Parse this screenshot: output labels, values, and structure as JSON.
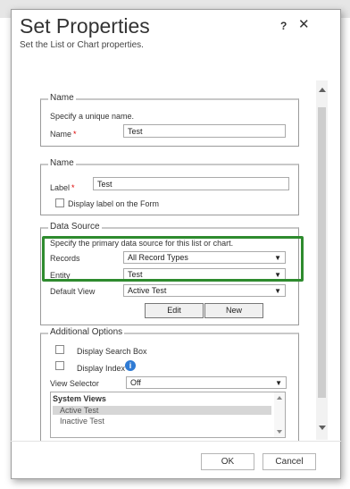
{
  "background": {
    "texts": [
      "...",
      "..."
    ]
  },
  "dialog": {
    "title": "Set Properties",
    "subtitle": "Set the List or Chart properties.",
    "help_label": "?",
    "close_label": "✕"
  },
  "name_section": {
    "title": "Name",
    "description": "Specify a unique name.",
    "name_label": "Name",
    "required_mark": "*",
    "name_value": "Test"
  },
  "label_section": {
    "title": "Name",
    "label_label": "Label",
    "required_mark": "*",
    "label_value": "Test",
    "display_label_text": "Display label on the Form",
    "display_label_checked": false
  },
  "data_source": {
    "title": "Data Source",
    "description": "Specify the primary data source for this list or chart.",
    "records_label": "Records",
    "records_value": "All Record Types",
    "entity_label": "Entity",
    "entity_value": "Test",
    "default_view_label": "Default View",
    "default_view_value": "Active Test",
    "edit_label": "Edit",
    "new_label": "New",
    "highlight_color": "#2e8b2e"
  },
  "additional_options": {
    "title": "Additional Options",
    "display_search_box": "Display Search Box",
    "display_index": "Display Index",
    "view_selector_label": "View Selector",
    "view_selector_value": "Off",
    "system_views_header": "System Views",
    "views": [
      "Active Test",
      "Inactive Test"
    ]
  },
  "footer": {
    "ok_label": "OK",
    "cancel_label": "Cancel"
  },
  "icons": {
    "caret": "▼",
    "info": "i"
  }
}
